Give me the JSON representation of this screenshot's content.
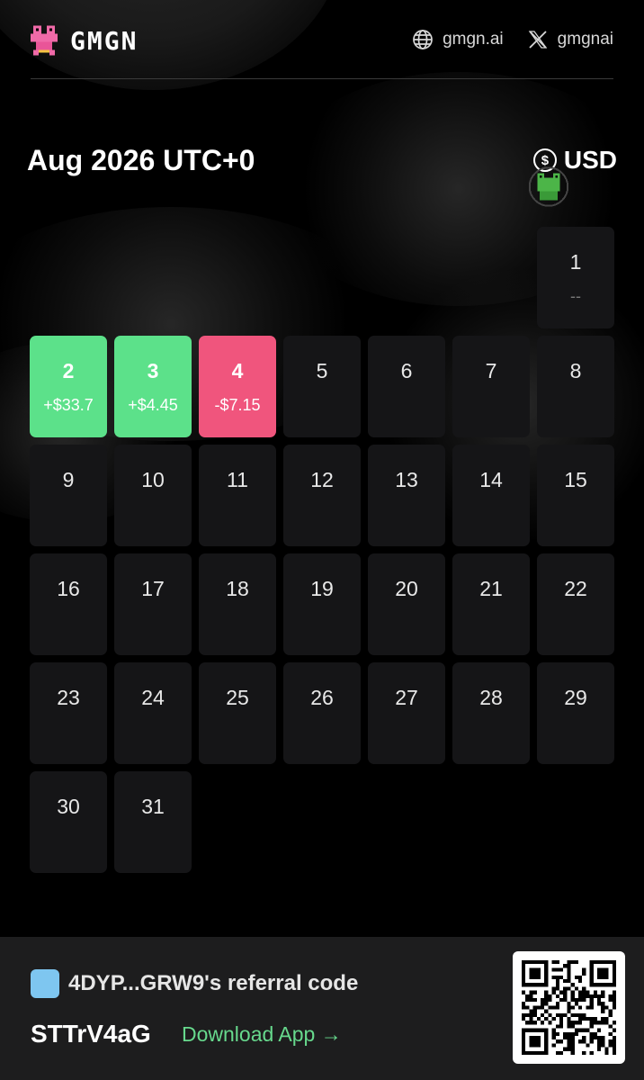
{
  "header": {
    "brand": "GMGN",
    "website": "gmgn.ai",
    "twitter": "gmgnai"
  },
  "calendar": {
    "title": "Aug 2026 UTC+0",
    "currency": "USD",
    "days": [
      {
        "day": "1",
        "value": "--",
        "status": "neutral"
      },
      {
        "day": "2",
        "value": "+$33.7",
        "status": "profit"
      },
      {
        "day": "3",
        "value": "+$4.45",
        "status": "profit"
      },
      {
        "day": "4",
        "value": "-$7.15",
        "status": "loss"
      },
      {
        "day": "5",
        "value": "",
        "status": "none"
      },
      {
        "day": "6",
        "value": "",
        "status": "none"
      },
      {
        "day": "7",
        "value": "",
        "status": "none"
      },
      {
        "day": "8",
        "value": "",
        "status": "none"
      },
      {
        "day": "9",
        "value": "",
        "status": "none"
      },
      {
        "day": "10",
        "value": "",
        "status": "none"
      },
      {
        "day": "11",
        "value": "",
        "status": "none"
      },
      {
        "day": "12",
        "value": "",
        "status": "none"
      },
      {
        "day": "13",
        "value": "",
        "status": "none"
      },
      {
        "day": "14",
        "value": "",
        "status": "none"
      },
      {
        "day": "15",
        "value": "",
        "status": "none"
      },
      {
        "day": "16",
        "value": "",
        "status": "none"
      },
      {
        "day": "17",
        "value": "",
        "status": "none"
      },
      {
        "day": "18",
        "value": "",
        "status": "none"
      },
      {
        "day": "19",
        "value": "",
        "status": "none"
      },
      {
        "day": "20",
        "value": "",
        "status": "none"
      },
      {
        "day": "21",
        "value": "",
        "status": "none"
      },
      {
        "day": "22",
        "value": "",
        "status": "none"
      },
      {
        "day": "23",
        "value": "",
        "status": "none"
      },
      {
        "day": "24",
        "value": "",
        "status": "none"
      },
      {
        "day": "25",
        "value": "",
        "status": "none"
      },
      {
        "day": "26",
        "value": "",
        "status": "none"
      },
      {
        "day": "27",
        "value": "",
        "status": "none"
      },
      {
        "day": "28",
        "value": "",
        "status": "none"
      },
      {
        "day": "29",
        "value": "",
        "status": "none"
      },
      {
        "day": "30",
        "value": "",
        "status": "none"
      },
      {
        "day": "31",
        "value": "",
        "status": "none"
      }
    ]
  },
  "footer": {
    "referral_label": "4DYP...GRW9's referral code",
    "code": "STTrV4aG",
    "download_label": "Download App →"
  },
  "colors": {
    "profit": "#5ce18a",
    "loss": "#f0557d",
    "cell": "#151517",
    "accent_link": "#67d98d"
  }
}
